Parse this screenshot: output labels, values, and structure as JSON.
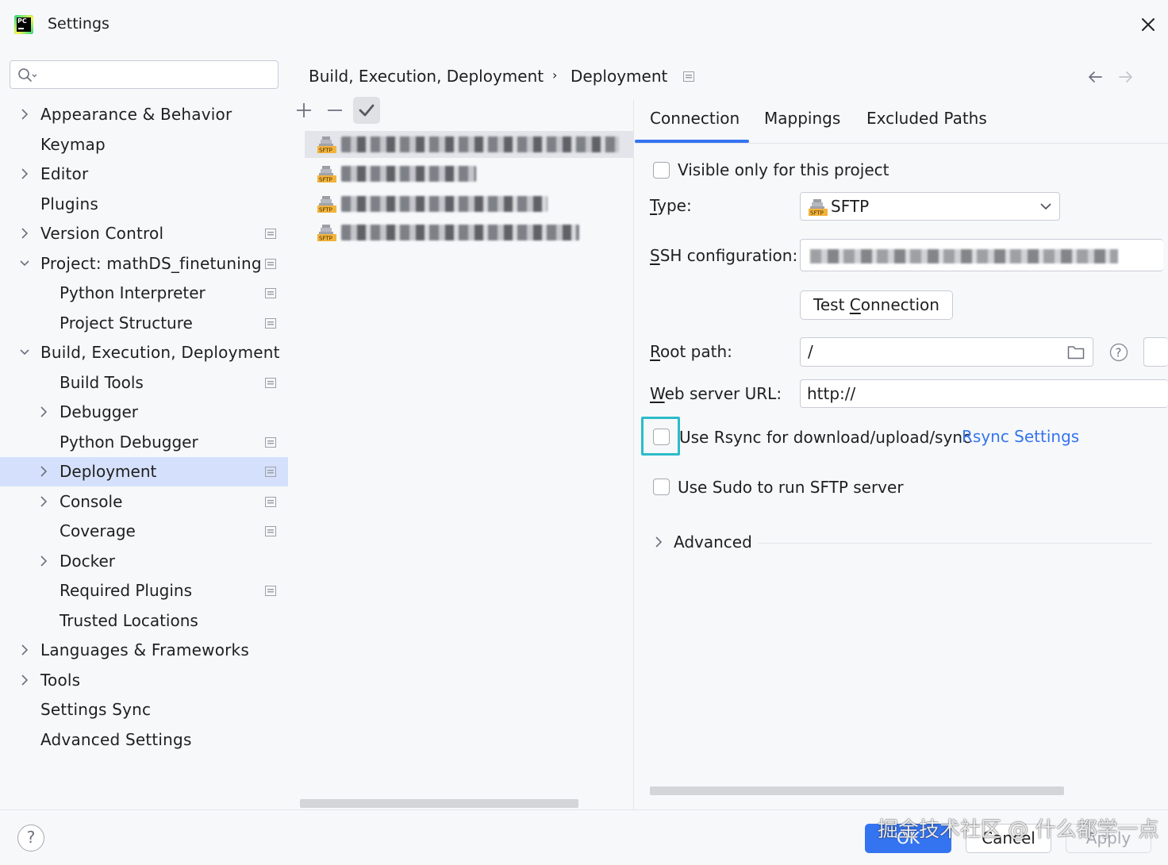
{
  "window": {
    "title": "Settings"
  },
  "nav": {
    "search_placeholder": "",
    "items": [
      {
        "label": "Appearance & Behavior",
        "level": 0,
        "expander": "collapsed",
        "project_scoped": false,
        "selected": false
      },
      {
        "label": "Keymap",
        "level": 0,
        "expander": "none",
        "project_scoped": false,
        "selected": false
      },
      {
        "label": "Editor",
        "level": 0,
        "expander": "collapsed",
        "project_scoped": false,
        "selected": false
      },
      {
        "label": "Plugins",
        "level": 0,
        "expander": "none",
        "project_scoped": false,
        "selected": false
      },
      {
        "label": "Version Control",
        "level": 0,
        "expander": "collapsed",
        "project_scoped": true,
        "selected": false
      },
      {
        "label": "Project: mathDS_finetuning",
        "level": 0,
        "expander": "expanded",
        "project_scoped": true,
        "selected": false
      },
      {
        "label": "Python Interpreter",
        "level": 1,
        "expander": "none",
        "project_scoped": true,
        "selected": false
      },
      {
        "label": "Project Structure",
        "level": 1,
        "expander": "none",
        "project_scoped": true,
        "selected": false
      },
      {
        "label": "Build, Execution, Deployment",
        "level": 0,
        "expander": "expanded",
        "project_scoped": false,
        "selected": false
      },
      {
        "label": "Build Tools",
        "level": 1,
        "expander": "none",
        "project_scoped": true,
        "selected": false
      },
      {
        "label": "Debugger",
        "level": 1,
        "expander": "collapsed",
        "project_scoped": false,
        "selected": false
      },
      {
        "label": "Python Debugger",
        "level": 1,
        "expander": "none",
        "project_scoped": true,
        "selected": false
      },
      {
        "label": "Deployment",
        "level": 1,
        "expander": "collapsed",
        "project_scoped": true,
        "selected": true
      },
      {
        "label": "Console",
        "level": 1,
        "expander": "collapsed",
        "project_scoped": true,
        "selected": false
      },
      {
        "label": "Coverage",
        "level": 1,
        "expander": "none",
        "project_scoped": true,
        "selected": false
      },
      {
        "label": "Docker",
        "level": 1,
        "expander": "collapsed",
        "project_scoped": false,
        "selected": false
      },
      {
        "label": "Required Plugins",
        "level": 1,
        "expander": "none",
        "project_scoped": true,
        "selected": false
      },
      {
        "label": "Trusted Locations",
        "level": 1,
        "expander": "none",
        "project_scoped": false,
        "selected": false
      },
      {
        "label": "Languages & Frameworks",
        "level": 0,
        "expander": "collapsed",
        "project_scoped": false,
        "selected": false
      },
      {
        "label": "Tools",
        "level": 0,
        "expander": "collapsed",
        "project_scoped": false,
        "selected": false
      },
      {
        "label": "Settings Sync",
        "level": 0,
        "expander": "none",
        "project_scoped": false,
        "selected": false
      },
      {
        "label": "Advanced Settings",
        "level": 0,
        "expander": "none",
        "project_scoped": false,
        "selected": false
      }
    ]
  },
  "breadcrumb": {
    "parent": "Build, Execution, Deployment",
    "separator": "›",
    "current": "Deployment"
  },
  "server_list": {
    "toolbar": [
      "add-icon",
      "remove-icon",
      "check-icon"
    ],
    "servers": [
      {
        "type_badge": "SFTP",
        "name_obscured": true,
        "selected": true
      },
      {
        "type_badge": "SFTP",
        "name_obscured": true,
        "selected": false
      },
      {
        "type_badge": "SFTP",
        "name_obscured": true,
        "selected": false
      },
      {
        "type_badge": "SFTP",
        "name_obscured": true,
        "selected": false
      }
    ]
  },
  "tabs": [
    {
      "label": "Connection",
      "active": true
    },
    {
      "label": "Mappings",
      "active": false
    },
    {
      "label": "Excluded Paths",
      "active": false
    }
  ],
  "connection": {
    "visible_only_label": "Visible only for this project",
    "visible_only_checked": false,
    "type_label_pre": "",
    "type_label_u": "T",
    "type_label_post": "ype:",
    "type_value": "SFTP",
    "ssh_label_u": "S",
    "ssh_label_post": "SH configuration:",
    "ssh_value_obscured": true,
    "test_connection_pre": "Test ",
    "test_connection_u": "C",
    "test_connection_post": "onnection",
    "root_label_u": "R",
    "root_label_post": "oot path:",
    "root_value": "/",
    "web_label_u": "W",
    "web_label_post": "eb server URL:",
    "web_value": "http://",
    "rsync_label": "Use Rsync for download/upload/sync",
    "rsync_checked": false,
    "rsync_link": "Rsync Settings",
    "sudo_label": "Use Sudo to run SFTP server",
    "sudo_checked": false,
    "advanced_label": "Advanced"
  },
  "footer": {
    "help": "?",
    "ok": "OK",
    "cancel": "Cancel",
    "apply": "Apply",
    "watermark": "掘金技术社区 @ 什么都学一点"
  },
  "colors": {
    "accent": "#3574f0",
    "selection": "#d5e1fc",
    "focus_ring": "#2cbcc9",
    "link": "#3574f0"
  }
}
